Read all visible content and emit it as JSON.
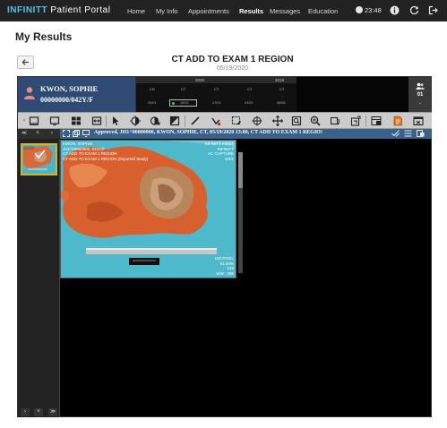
{
  "nav": {
    "brand_a": "INFINITT",
    "brand_b": "Patient Portal",
    "items": [
      {
        "label": "Home"
      },
      {
        "label": "My Info"
      },
      {
        "label": "Appointments"
      },
      {
        "label": "Results"
      },
      {
        "label": "Messages"
      },
      {
        "label": "Education"
      }
    ],
    "active": "Results",
    "clock": "23:48",
    "icons": [
      "info-icon",
      "refresh-icon",
      "logout-icon"
    ]
  },
  "page": {
    "title": "My Results",
    "back_icon": "arrow-left-icon",
    "study_title": "CT ADD TO EXAM 1 REGION",
    "study_date": "05/19/2020"
  },
  "viewer": {
    "patient_name": "KWON, SOPHIE",
    "patient_id": "00000000/042Y/F",
    "timeline": {
      "years": [
        "2020",
        "2019"
      ],
      "modalities": [
        "CR",
        "CT",
        "CT",
        "CT",
        "CT"
      ],
      "dashes": [
        "-",
        "-",
        "-",
        "-",
        "-"
      ],
      "dates": [
        "20/01",
        "19/02",
        "17/01",
        "03/02",
        "08/08"
      ]
    },
    "count": "01",
    "approved_text": "Approved, JH1^00000000, KWON, SOPHIE, CT, 05/19/2020 13:00, CT ADD TO EXAM 1 REGIO!",
    "overlay": {
      "top_left": [
        "KWON, SOPHIE",
        "JH1^00000000, 042Y/F",
        "CT ADD TO EXAM 1 REGION",
        "CT ADD TO EXAM 1 REGION (Imported Study)"
      ],
      "top_right": [
        "INFINITT FIRST",
        "INFINITT",
        "AC CAPTURE",
        "3/3/1"
      ],
      "bottom_right": [
        "100 PIXEL",
        "51.60%",
        "128",
        "WW : 256"
      ]
    },
    "colors": {
      "patient_bg": "#2f4b73",
      "approved_bg": "#3a6189",
      "toolbar_bg": "#cccccc",
      "image_bg": "#4fb9cc"
    }
  }
}
